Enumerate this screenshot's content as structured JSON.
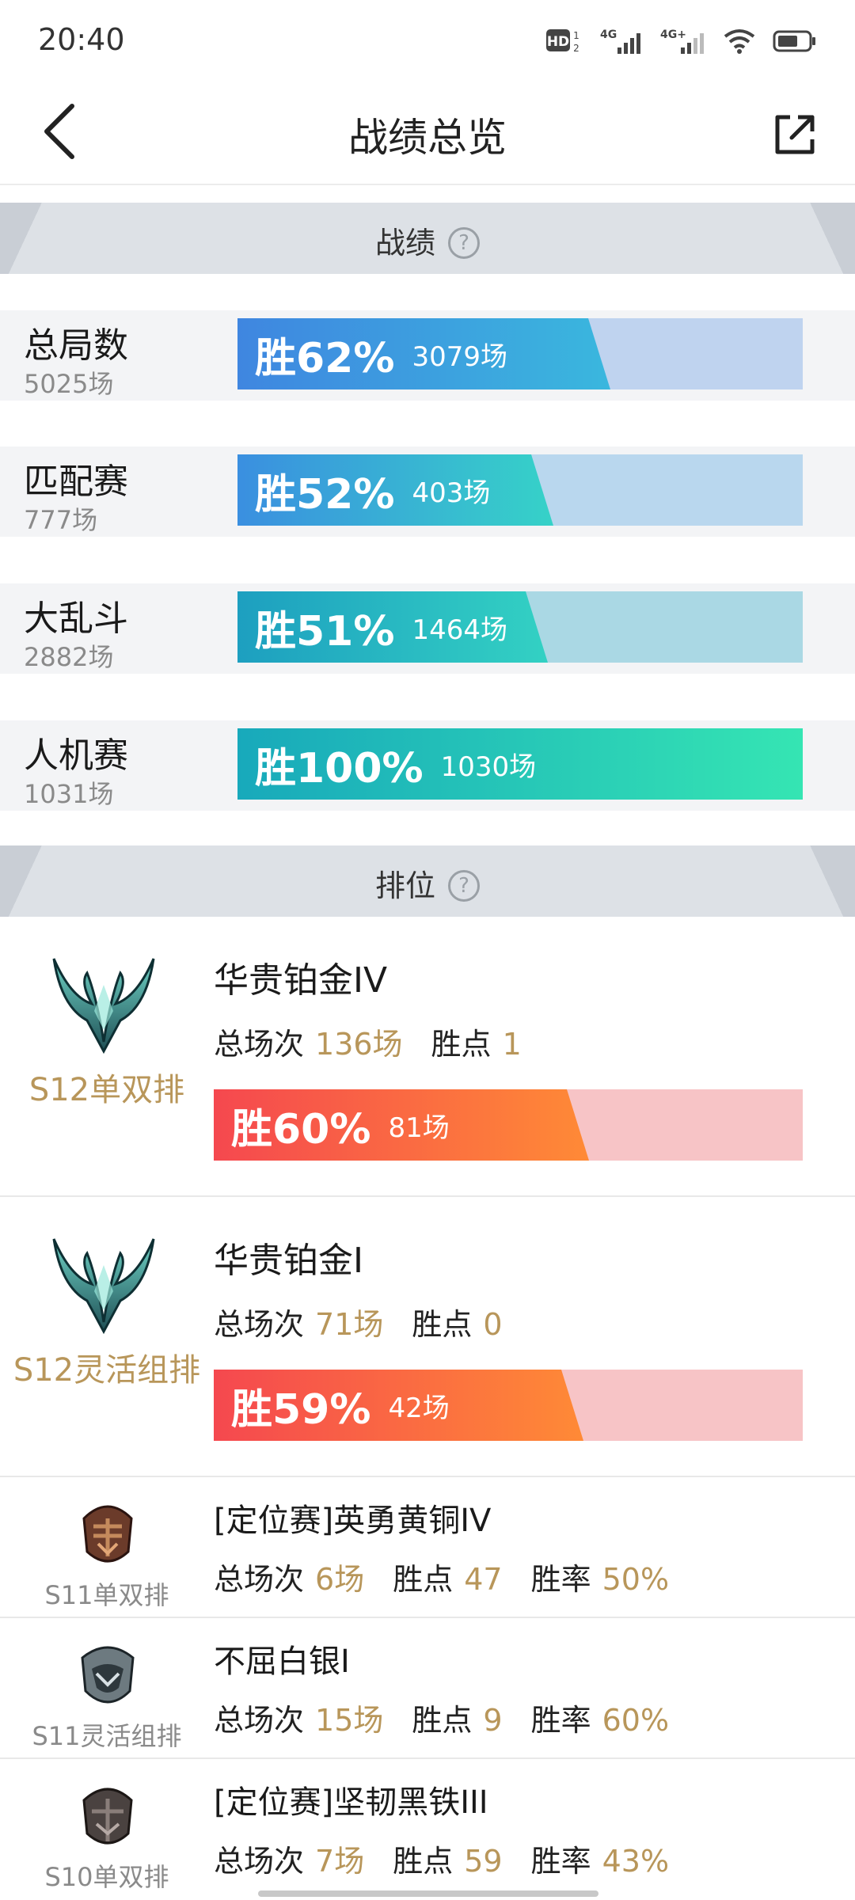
{
  "status": {
    "time": "20:40",
    "hd": "HD",
    "hd_sub": "1 2",
    "net1": "4G",
    "net2": "4G+"
  },
  "header": {
    "title": "战绩总览"
  },
  "sections": {
    "stats_title": "战绩",
    "rank_title": "排位",
    "help_glyph": "?"
  },
  "stats": [
    {
      "name": "总局数",
      "count": "5025场",
      "win": "胜62%",
      "games": "3079场",
      "win_fraction": 0.62,
      "fill_color": "#3f86e0",
      "fill_color2": "#3ab7de",
      "track_color": "#bfd3ef"
    },
    {
      "name": "匹配赛",
      "count": "777场",
      "win": "胜52%",
      "games": "403场",
      "win_fraction": 0.52,
      "fill_color": "#3a8fe0",
      "fill_color2": "#36d2c8",
      "track_color": "#b9d7ee"
    },
    {
      "name": "大乱斗",
      "count": "2882场",
      "win": "胜51%",
      "games": "1464场",
      "win_fraction": 0.51,
      "fill_color": "#1d9fc0",
      "fill_color2": "#33d1c3",
      "track_color": "#aad8e4"
    },
    {
      "name": "人机赛",
      "count": "1031场",
      "win": "胜100%",
      "games": "1030场",
      "win_fraction": 1.0,
      "fill_color": "#18a9bb",
      "fill_color2": "#35e5b3",
      "track_color": "#aee6dd"
    }
  ],
  "ranked_major": [
    {
      "queue": "S12单双排",
      "tier": "华贵铂金IV",
      "total_label": "总场次",
      "total": "136场",
      "lp_label": "胜点",
      "lp": "1",
      "win": "胜60%",
      "games": "81场",
      "win_fraction": 0.6
    },
    {
      "queue": "S12灵活组排",
      "tier": "华贵铂金I",
      "total_label": "总场次",
      "total": "71场",
      "lp_label": "胜点",
      "lp": "0",
      "win": "胜59%",
      "games": "42场",
      "win_fraction": 0.59
    }
  ],
  "ranked_history": [
    {
      "queue": "S11单双排",
      "tier": "[定位赛]英勇黄铜IV",
      "total_label": "总场次",
      "total": "6场",
      "lp_label": "胜点",
      "lp": "47",
      "rate_label": "胜率",
      "rate": "50%",
      "emblem": "bronze"
    },
    {
      "queue": "S11灵活组排",
      "tier": "不屈白银I",
      "total_label": "总场次",
      "total": "15场",
      "lp_label": "胜点",
      "lp": "9",
      "rate_label": "胜率",
      "rate": "60%",
      "emblem": "silver"
    },
    {
      "queue": "S10单双排",
      "tier": "[定位赛]坚韧黑铁III",
      "total_label": "总场次",
      "total": "7场",
      "lp_label": "胜点",
      "lp": "59",
      "rate_label": "胜率",
      "rate": "43%",
      "emblem": "iron"
    }
  ],
  "colors": {
    "accent_gold": "#b8965a",
    "rank_fill": "#f5484f",
    "rank_fill2": "#ff8a36",
    "rank_track": "#f7c4c6"
  }
}
